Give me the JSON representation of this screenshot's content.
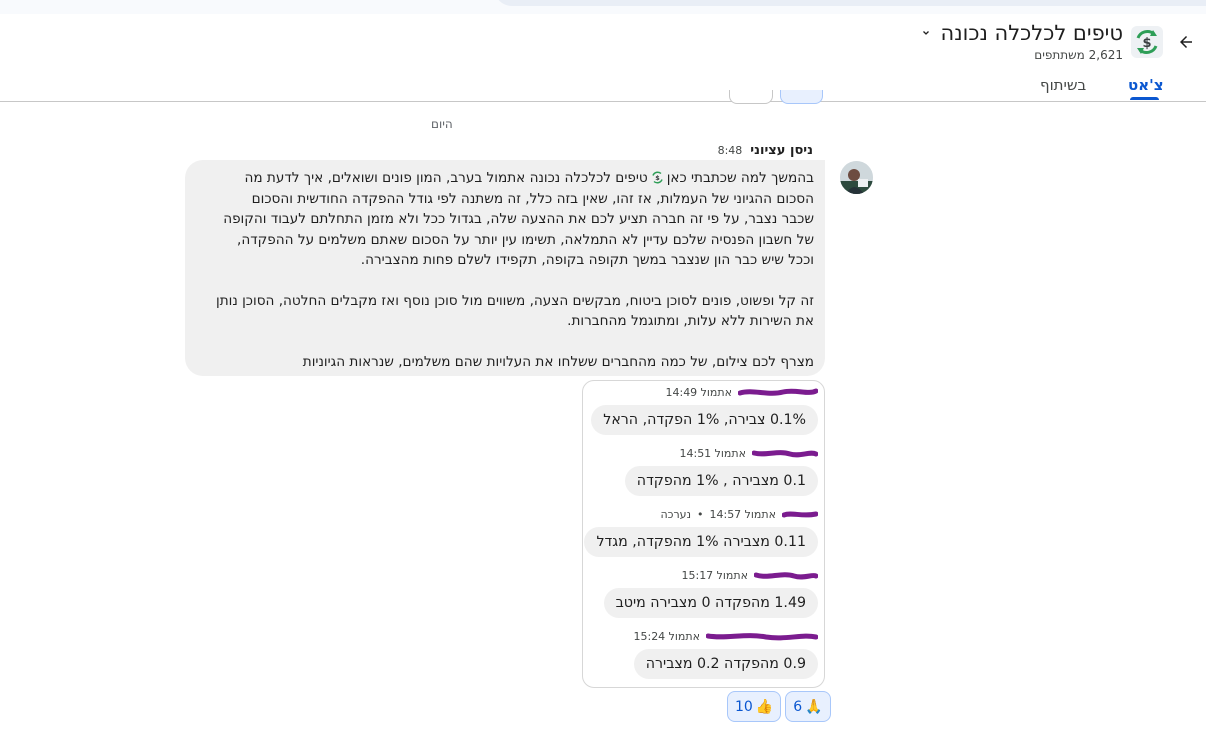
{
  "header": {
    "title": "טיפים לכלכלה נכונה",
    "members": "2,621 משתתפים",
    "back_icon": "arrow-back-icon",
    "space_icon": "dollar-recycle-icon",
    "dropdown_icon": "chevron-down-icon"
  },
  "tabs": [
    {
      "label": "צ'אט",
      "active": true
    },
    {
      "label": "בשיתוף",
      "active": false
    }
  ],
  "day_separator": "היום",
  "message": {
    "sender": "ניסן עציוני",
    "time": "8:48",
    "lines": [
      "בהמשך למה שכתבתי כאן",
      "טיפים לכלכלה נכונה",
      "אתמול בערב, המון פונים ושואלים, איך לדעת מה",
      "הסכום ההגיוני של העמלות, אז זהו, שאין בזה כלל, זה משתנה לפי גודל ההפקדה החודשית והסכום",
      "שכבר נצבר, על פי זה חברה תציע לכם את ההצעה שלה, בגדול ככל ולא מזמן התחלתם לעבוד והקופה",
      "של חשבון הפנסיה שלכם עדיין לא התמלאה, תשימו עין יותר על הסכום שאתם משלמים על ההפקדה,",
      "וככל שיש כבר הון שנצבר במשך תקופה בקופה, תקפידו לשלם פחות מהצבירה.",
      "זה קל ופשוט, פונים לסוכן ביטוח, מבקשים הצעה, משווים מול סוכן נוסף ואז מקבלים החלטה, הסוכן נותן",
      "את השירות ללא עלות, ומתוגמל מהחברות.",
      "מצרף לכם צילום, של כמה מהחברים ששלחו את העלויות שהם משלמים, שנראות הגיוניות"
    ]
  },
  "screenshot_replies": [
    {
      "time": "אתמול 14:49",
      "edited": "",
      "text": "0.1% צבירה, 1% הפקדה, הראל"
    },
    {
      "time": "אתמול 14:51",
      "edited": "",
      "text": "0.1 מצבירה , 1% מהפקדה"
    },
    {
      "time": "אתמול 14:57",
      "edited": "נערכה",
      "text": "0.11 מצבירה  1% מהפקדה, מגדל"
    },
    {
      "time": "אתמול 15:17",
      "edited": "",
      "text": "1.49 מהפקדה 0 מצבירה מיטב"
    },
    {
      "time": "אתמול 15:24",
      "edited": "",
      "text": "0.9 מהפקדה 0.2 מצבירה"
    }
  ],
  "reactions": [
    {
      "emoji": "👍",
      "count": "10"
    },
    {
      "emoji": "🙏",
      "count": "6"
    }
  ],
  "colors": {
    "accent": "#0b57d0",
    "bubble": "#f0f0f0",
    "redaction": "#7b1c8f"
  }
}
